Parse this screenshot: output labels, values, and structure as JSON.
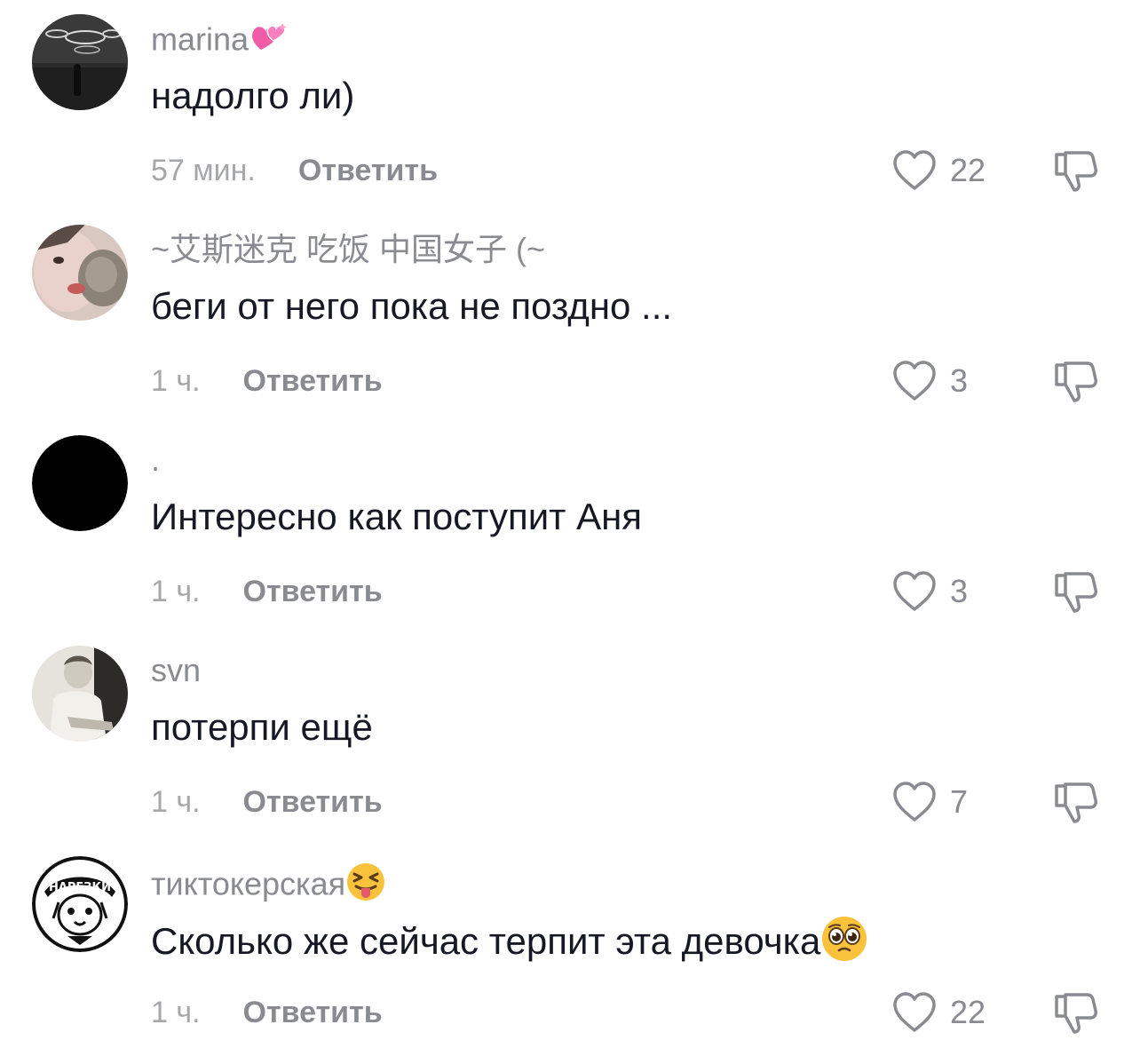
{
  "comments": [
    {
      "username": "marina",
      "username_emoji": "sparkling-hearts",
      "text": "надолго ли)",
      "time": "57 мин.",
      "reply_label": "Ответить",
      "likes": "22",
      "avatar": "dark-hallway-photo"
    },
    {
      "username": "~艾斯迷克  吃饭  中国女子 (~",
      "text": "беги от него пока не поздно ...",
      "time": "1 ч.",
      "reply_label": "Ответить",
      "likes": "3",
      "avatar": "girl-with-cat-photo"
    },
    {
      "username": ".",
      "text": "Интересно как поступит Аня",
      "time": "1 ч.",
      "reply_label": "Ответить",
      "likes": "3",
      "avatar": "black-circle"
    },
    {
      "username": "svn",
      "text": "потерпи ещё",
      "time": "1 ч.",
      "reply_label": "Ответить",
      "likes": "7",
      "avatar": "bw-person-photo"
    },
    {
      "username": "тиктокерская",
      "username_emoji": "squinting-tongue-face",
      "text": "Сколько же сейчас терпит эта девочка",
      "text_emoji": "pleading-face",
      "time": "1 ч.",
      "reply_label": "Ответить",
      "likes": "22",
      "avatar": "нарезки",
      "avatar_logo_text": "НАРЕЗКИ"
    }
  ],
  "colors": {
    "primary_text": "#161823",
    "secondary_text": "#8a8b91",
    "time_text": "#a6a7ab",
    "icon_stroke": "#8a8b91"
  }
}
